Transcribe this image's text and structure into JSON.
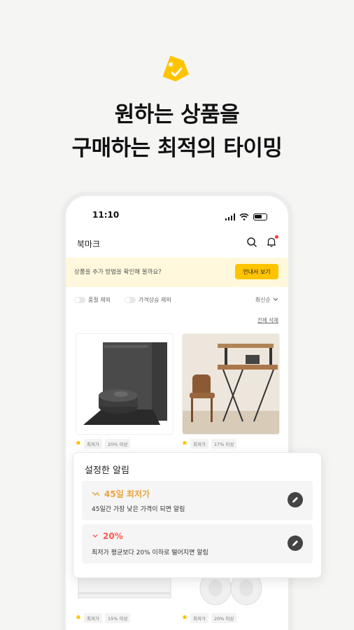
{
  "colors": {
    "brand_yellow": "#ffc400",
    "alert_orange": "#e8a33c",
    "alert_red": "#ff5a4e",
    "bg": "#f5f5f4"
  },
  "headline": {
    "line1": "원하는 상품을",
    "line2": "구매하는 최적의 타이밍"
  },
  "status_bar": {
    "time": "11:10"
  },
  "app_bar": {
    "title": "북마크",
    "icons": [
      "search-icon",
      "bell-icon"
    ]
  },
  "banner": {
    "text": "상품을 추가 방법을 확인해 볼까요?",
    "button": "안내서 보기"
  },
  "filters": {
    "toggle1": "품절 제외",
    "toggle2": "가격상승 제외",
    "sort": "최신순"
  },
  "delete_all": "전체 삭제",
  "products": [
    {
      "name": "robot-vacuum",
      "tags": [
        "최저가",
        "20% 이상"
      ]
    },
    {
      "name": "wooden-desk",
      "tags": [
        "최저가",
        "17% 이상"
      ]
    },
    {
      "name": "air-conditioner",
      "tags": [
        "최저가",
        "15% 이상"
      ]
    },
    {
      "name": "earbuds",
      "tags": [
        "최저가",
        "20% 이상"
      ]
    }
  ],
  "alert_popup": {
    "title": "설정한 알림",
    "alerts": [
      {
        "label": "45일 최저가",
        "desc": "45일간 가장 낮은 가격이 되면 알림",
        "color": "#e8a33c"
      },
      {
        "label": "20%",
        "desc": "최저가 평균보다 20% 이하로 떨어지면 알림",
        "color": "#ff5a4e"
      }
    ]
  }
}
